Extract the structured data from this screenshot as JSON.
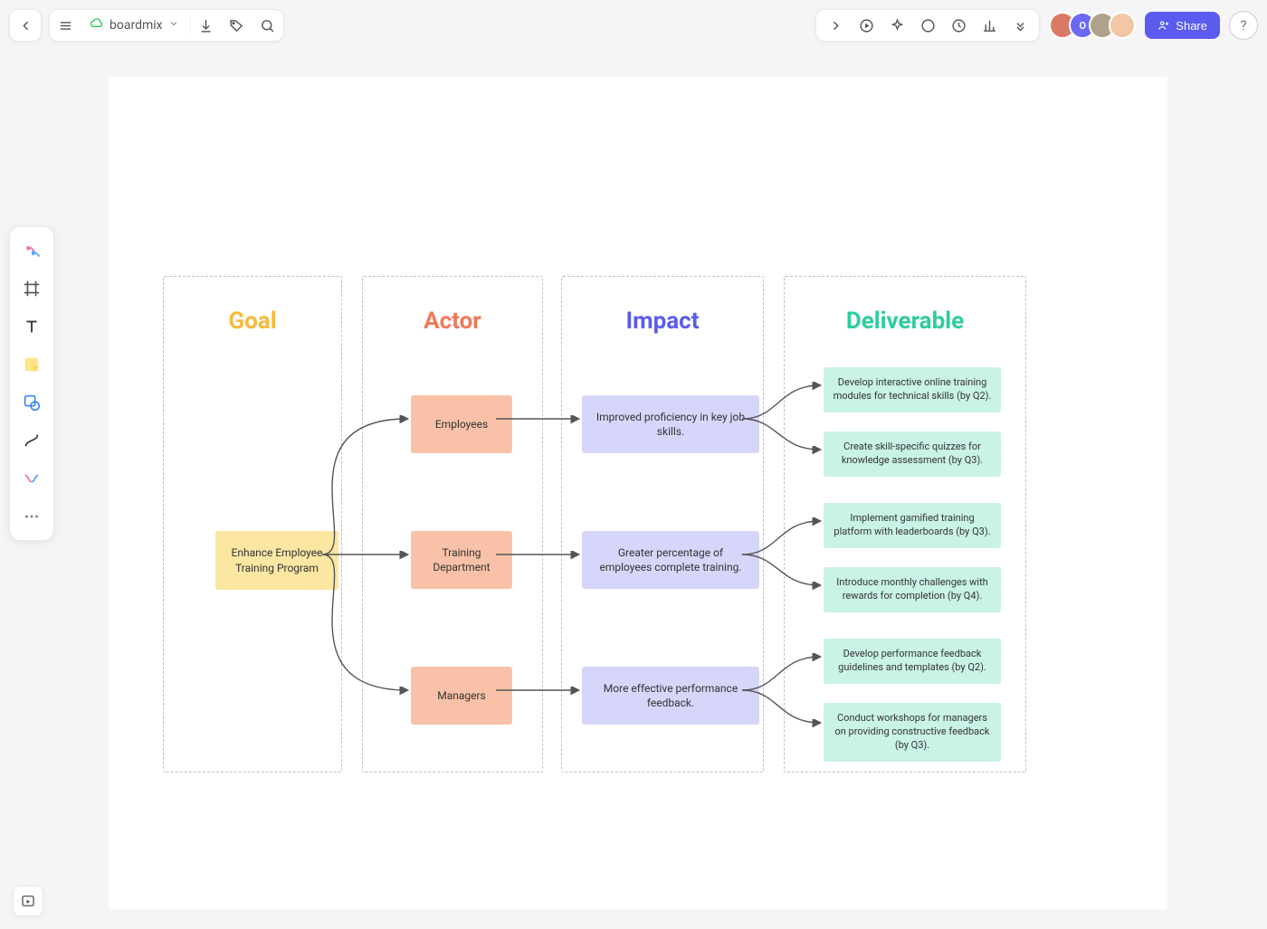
{
  "header": {
    "app_name": "boardmix",
    "share_label": "Share"
  },
  "avatars": [
    {
      "initial": "",
      "bg": "#d97a66"
    },
    {
      "initial": "O",
      "bg": "#6a6af5"
    },
    {
      "initial": "",
      "bg": "#b0a28a"
    },
    {
      "initial": "",
      "bg": "#f3c6a5"
    }
  ],
  "lanes": {
    "goal": "Goal",
    "actor": "Actor",
    "impact": "Impact",
    "deliv": "Deliverable"
  },
  "nodes": {
    "goal": "Enhance Employee Training Program",
    "actor0": "Employees",
    "actor1": "Training Department",
    "actor2": "Managers",
    "impact0": "Improved proficiency in key job skills.",
    "impact1": "Greater percentage of employees complete training.",
    "impact2": "More effective performance feedback.",
    "deliv0": "Develop interactive online training modules for technical skills (by Q2).",
    "deliv1": "Create skill-specific quizzes for knowledge assessment (by Q3).",
    "deliv2": "Implement gamified training platform with leaderboards (by Q3).",
    "deliv3": "Introduce monthly challenges with rewards for completion (by Q4).",
    "deliv4": "Develop performance feedback guidelines and templates (by Q2).",
    "deliv5": "Conduct workshops for managers on providing constructive feedback (by Q3)."
  }
}
